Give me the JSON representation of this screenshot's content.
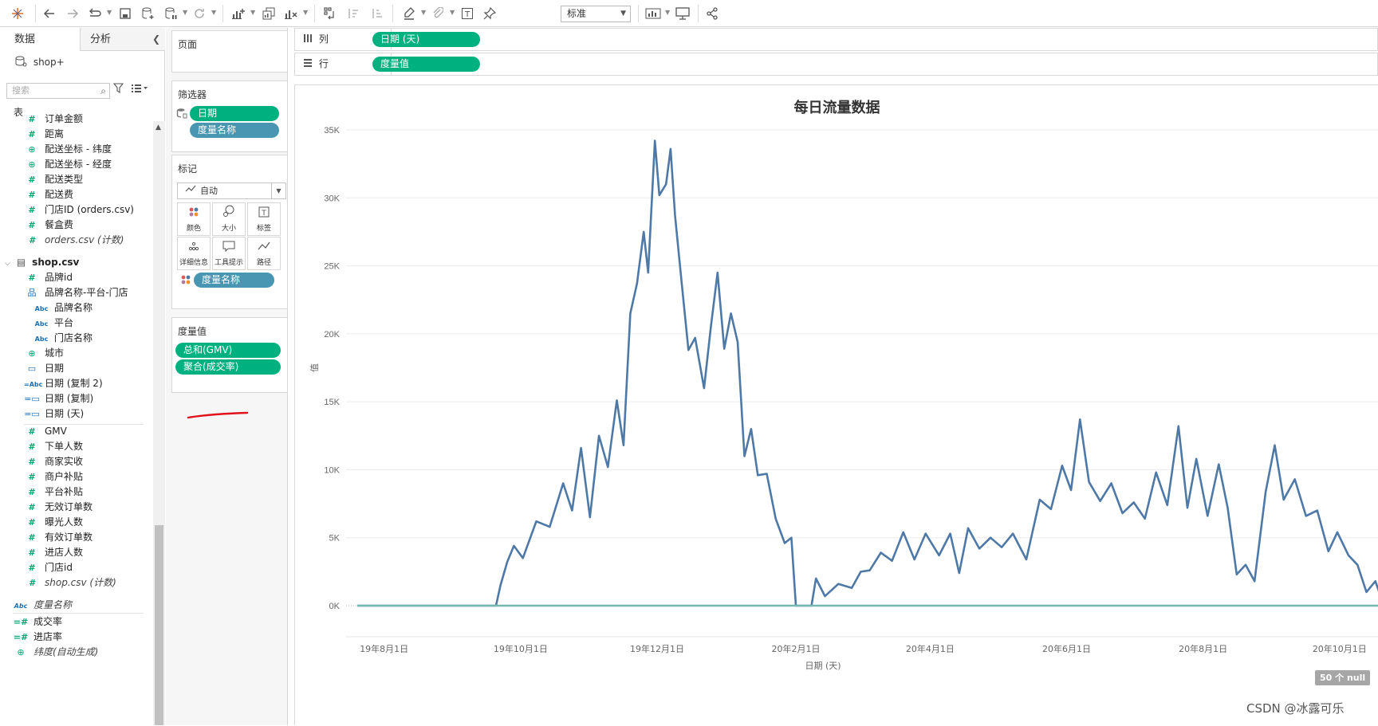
{
  "toolbar": {
    "fit_select": "标准",
    "icons": [
      "tableau-logo-icon",
      "undo-icon",
      "redo-icon",
      "replay-icon",
      "save-icon",
      "new-datasource-icon",
      "pause-update-icon",
      "refresh-icon",
      "new-worksheet-icon",
      "duplicate-sheet-icon",
      "clear-sheet-icon",
      "swap-rows-columns-icon",
      "sort-ascending-icon",
      "sort-descending-icon",
      "highlight-icon",
      "group-icon",
      "show-labels-icon",
      "pin-icon",
      "show-me-icon",
      "presentation-icon",
      "share-icon"
    ]
  },
  "data_pane": {
    "tab_data": "数据",
    "tab_analysis": "分析",
    "datasource": "shop+",
    "search_placeholder": "搜索",
    "tables_label": "表",
    "orders_fields": [
      {
        "icon": "number",
        "name": "订单金额"
      },
      {
        "icon": "number",
        "name": "距离"
      },
      {
        "icon": "geo",
        "name": "配送坐标 - 纬度"
      },
      {
        "icon": "geo",
        "name": "配送坐标 - 经度"
      },
      {
        "icon": "number",
        "name": "配送类型"
      },
      {
        "icon": "number",
        "name": "配送费"
      },
      {
        "icon": "number",
        "name": "门店ID (orders.csv)"
      },
      {
        "icon": "number",
        "name": "餐盒费"
      },
      {
        "icon": "number",
        "name": "orders.csv (计数)"
      }
    ],
    "shop_table": "shop.csv",
    "shop_dimensions": [
      {
        "icon": "number",
        "name": "品牌id",
        "indent": 0
      },
      {
        "icon": "hierarchy",
        "name": "品牌名称-平台-门店",
        "indent": 0
      },
      {
        "icon": "string",
        "name": "品牌名称",
        "indent": 1
      },
      {
        "icon": "string",
        "name": "平台",
        "indent": 1
      },
      {
        "icon": "string",
        "name": "门店名称",
        "indent": 1
      },
      {
        "icon": "geo",
        "name": "城市",
        "indent": 0
      },
      {
        "icon": "date",
        "name": "日期",
        "indent": 0
      },
      {
        "icon": "string-calc",
        "name": "日期 (复制 2)",
        "indent": 0
      },
      {
        "icon": "date-calc",
        "name": "日期 (复制)",
        "indent": 0
      },
      {
        "icon": "date-calc",
        "name": "日期 (天)",
        "indent": 0
      }
    ],
    "shop_measures": [
      {
        "icon": "number",
        "name": "GMV"
      },
      {
        "icon": "number",
        "name": "下单人数"
      },
      {
        "icon": "number",
        "name": "商家实收"
      },
      {
        "icon": "number",
        "name": "商户补贴"
      },
      {
        "icon": "number",
        "name": "平台补贴"
      },
      {
        "icon": "number",
        "name": "无效订单数"
      },
      {
        "icon": "number",
        "name": "曝光人数"
      },
      {
        "icon": "number",
        "name": "有效订单数"
      },
      {
        "icon": "number",
        "name": "进店人数"
      },
      {
        "icon": "number",
        "name": "门店id"
      },
      {
        "icon": "number",
        "name": "shop.csv (计数)"
      }
    ],
    "measure_names": "度量名称",
    "calc_fields": [
      {
        "icon": "number-calc",
        "name": "成交率"
      },
      {
        "icon": "number-calc",
        "name": "进店率"
      },
      {
        "icon": "geo",
        "name": "纬度(自动生成)"
      }
    ]
  },
  "shelves": {
    "pages_label": "页面",
    "filters_label": "筛选器",
    "filters": [
      "日期",
      "度量名称"
    ],
    "marks_label": "标记",
    "mark_type": "自动",
    "mark_buttons": [
      "颜色",
      "大小",
      "标签",
      "详细信息",
      "工具提示",
      "路径"
    ],
    "marks_color_pill": "度量名称",
    "measure_values_label": "度量值",
    "measure_values": [
      "总和(GMV)",
      "聚合(成交率)"
    ],
    "columns_label": "列",
    "columns_pill": "日期 (天)",
    "rows_label": "行",
    "rows_pill": "度量值"
  },
  "view": {
    "title": "每日流量数据",
    "null_badge": "50 个 null",
    "watermark": "CSDN @冰露可乐"
  },
  "chart_data": {
    "type": "line",
    "title": "每日流量数据",
    "ylabel": "值",
    "xlabel": "日期 (天)",
    "y_ticks": [
      "35K",
      "30K",
      "25K",
      "20K",
      "15K",
      "10K",
      "5K",
      "0K"
    ],
    "x_ticks": [
      "19年8月1日",
      "19年10月1日",
      "19年12月1日",
      "20年2月1日",
      "20年4月1日",
      "20年6月1日",
      "20年8月1日",
      "20年10月1日"
    ],
    "ylim": [
      0,
      35000
    ],
    "grid": true,
    "series": [
      {
        "name": "总和(GMV)",
        "color": "#4e79a7",
        "points": [
          [
            "2019-07-20",
            0
          ],
          [
            "2019-09-20",
            0
          ],
          [
            "2019-09-22",
            1500
          ],
          [
            "2019-09-25",
            3200
          ],
          [
            "2019-09-28",
            4400
          ],
          [
            "2019-10-02",
            3500
          ],
          [
            "2019-10-08",
            6200
          ],
          [
            "2019-10-14",
            5800
          ],
          [
            "2019-10-20",
            9000
          ],
          [
            "2019-10-24",
            7000
          ],
          [
            "2019-10-28",
            11600
          ],
          [
            "2019-11-01",
            6500
          ],
          [
            "2019-11-05",
            12500
          ],
          [
            "2019-11-09",
            10200
          ],
          [
            "2019-11-13",
            15100
          ],
          [
            "2019-11-16",
            11800
          ],
          [
            "2019-11-19",
            21500
          ],
          [
            "2019-11-22",
            23700
          ],
          [
            "2019-11-25",
            27500
          ],
          [
            "2019-11-27",
            24500
          ],
          [
            "2019-11-30",
            34200
          ],
          [
            "2019-12-02",
            30200
          ],
          [
            "2019-12-05",
            31000
          ],
          [
            "2019-12-07",
            33600
          ],
          [
            "2019-12-09",
            28700
          ],
          [
            "2019-12-12",
            23700
          ],
          [
            "2019-12-15",
            18800
          ],
          [
            "2019-12-18",
            19700
          ],
          [
            "2019-12-22",
            16000
          ],
          [
            "2019-12-25",
            20500
          ],
          [
            "2019-12-28",
            24500
          ],
          [
            "2019-12-31",
            18900
          ],
          [
            "2020-01-03",
            21500
          ],
          [
            "2020-01-06",
            19400
          ],
          [
            "2020-01-09",
            11000
          ],
          [
            "2020-01-12",
            13000
          ],
          [
            "2020-01-15",
            9600
          ],
          [
            "2020-01-19",
            9700
          ],
          [
            "2020-01-23",
            6400
          ],
          [
            "2020-01-27",
            4600
          ],
          [
            "2020-01-30",
            5000
          ],
          [
            "2020-02-01",
            0
          ],
          [
            "2020-02-08",
            0
          ],
          [
            "2020-02-10",
            2000
          ],
          [
            "2020-02-14",
            700
          ],
          [
            "2020-02-20",
            1600
          ],
          [
            "2020-02-26",
            1300
          ],
          [
            "2020-03-01",
            2500
          ],
          [
            "2020-03-05",
            2600
          ],
          [
            "2020-03-10",
            3900
          ],
          [
            "2020-03-15",
            3300
          ],
          [
            "2020-03-20",
            5400
          ],
          [
            "2020-03-25",
            3400
          ],
          [
            "2020-03-30",
            5300
          ],
          [
            "2020-04-05",
            3700
          ],
          [
            "2020-04-10",
            5300
          ],
          [
            "2020-04-14",
            2400
          ],
          [
            "2020-04-18",
            5700
          ],
          [
            "2020-04-23",
            4200
          ],
          [
            "2020-04-28",
            5000
          ],
          [
            "2020-05-03",
            4300
          ],
          [
            "2020-05-08",
            5300
          ],
          [
            "2020-05-14",
            3400
          ],
          [
            "2020-05-20",
            7800
          ],
          [
            "2020-05-25",
            7100
          ],
          [
            "2020-05-30",
            10300
          ],
          [
            "2020-06-03",
            8500
          ],
          [
            "2020-06-07",
            13700
          ],
          [
            "2020-06-11",
            9100
          ],
          [
            "2020-06-16",
            7700
          ],
          [
            "2020-06-21",
            9000
          ],
          [
            "2020-06-26",
            6800
          ],
          [
            "2020-07-01",
            7600
          ],
          [
            "2020-07-06",
            6400
          ],
          [
            "2020-07-11",
            9800
          ],
          [
            "2020-07-16",
            7400
          ],
          [
            "2020-07-21",
            13200
          ],
          [
            "2020-07-25",
            7200
          ],
          [
            "2020-07-29",
            10800
          ],
          [
            "2020-08-03",
            6600
          ],
          [
            "2020-08-08",
            10400
          ],
          [
            "2020-08-12",
            7200
          ],
          [
            "2020-08-16",
            2300
          ],
          [
            "2020-08-20",
            3000
          ],
          [
            "2020-08-24",
            1800
          ],
          [
            "2020-08-29",
            8400
          ],
          [
            "2020-09-02",
            11800
          ],
          [
            "2020-09-06",
            7800
          ],
          [
            "2020-09-11",
            9300
          ],
          [
            "2020-09-16",
            6600
          ],
          [
            "2020-09-21",
            7000
          ],
          [
            "2020-09-26",
            4000
          ],
          [
            "2020-09-30",
            5400
          ],
          [
            "2020-10-05",
            3700
          ],
          [
            "2020-10-09",
            3000
          ],
          [
            "2020-10-13",
            1000
          ],
          [
            "2020-10-17",
            1800
          ],
          [
            "2020-10-20",
            400
          ],
          [
            "2020-10-22",
            800
          ]
        ]
      },
      {
        "name": "聚合(成交率)",
        "color": "#76b7b2",
        "points": [
          [
            "2019-07-20",
            0
          ],
          [
            "2020-10-22",
            0
          ]
        ]
      }
    ]
  }
}
